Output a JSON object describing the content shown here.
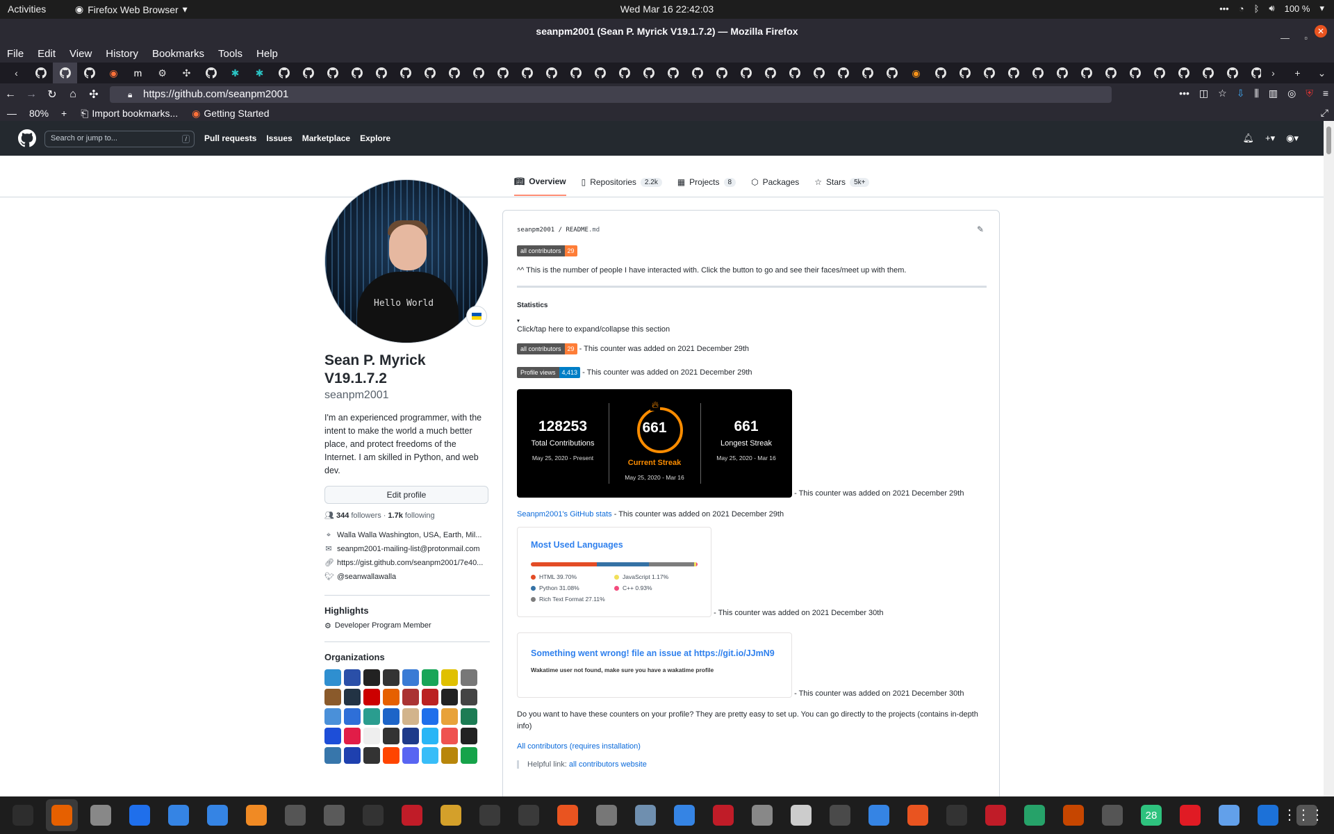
{
  "gnome": {
    "activities": "Activities",
    "app_menu": "Firefox Web Browser",
    "clock": "Wed Mar 16  22:42:03",
    "battery": "100 %"
  },
  "window": {
    "title": "seanpm2001 (Sean P. Myrick V19.1.7.2) — Mozilla Firefox"
  },
  "menubar": [
    "File",
    "Edit",
    "View",
    "History",
    "Bookmarks",
    "Tools",
    "Help"
  ],
  "browser": {
    "url": "https://github.com/seanpm2001",
    "zoom_level": "80%",
    "bookmarks": [
      "Import bookmarks...",
      "Getting Started"
    ]
  },
  "github": {
    "search_placeholder": "Search or jump to...",
    "search_key": "/",
    "nav": [
      "Pull requests",
      "Issues",
      "Marketplace",
      "Explore"
    ],
    "tabs": [
      {
        "label": "Overview",
        "count": ""
      },
      {
        "label": "Repositories",
        "count": "2.2k"
      },
      {
        "label": "Projects",
        "count": "8"
      },
      {
        "label": "Packages",
        "count": ""
      },
      {
        "label": "Stars",
        "count": "5k+"
      }
    ]
  },
  "profile": {
    "avatar_shirt_text": "Hello World",
    "name_line1": "Sean P. Myrick",
    "name_line2": "V19.1.7.2",
    "login": "seanpm2001",
    "bio": "I'm an experienced programmer, with the intent to make the world a much better place, and protect freedoms of the Internet. I am skilled in Python, and web dev.",
    "edit_button": "Edit profile",
    "followers_count": "344",
    "followers_label": "followers",
    "following_count": "1.7k",
    "following_label": "following",
    "location": "Walla Walla Washington, USA, Earth, Mil...",
    "email": "seanpm2001-mailing-list@protonmail.com",
    "website": "https://gist.github.com/seanpm2001/7e40...",
    "twitter": "@seanwallawalla",
    "highlights_title": "Highlights",
    "highlight_item": "Developer Program Member",
    "organizations_title": "Organizations",
    "org_colors": [
      "#2f8fd0",
      "#2a4fa8",
      "#222",
      "#333",
      "#3a7bd5",
      "#18a558",
      "#e0c000",
      "#777",
      "#8a5a2b",
      "#234",
      "#c00",
      "#e66000",
      "#a33",
      "#b22",
      "#222",
      "#444",
      "#4a90d9",
      "#2e6fd8",
      "#2a9d8f",
      "#1c64c8",
      "#d2b48c",
      "#1f6feb",
      "#e8a23a",
      "#1c7c54",
      "#1d4ed8",
      "#e11d48",
      "#eee",
      "#333",
      "#1e3a8a",
      "#29b6f6",
      "#ef5350",
      "#222",
      "#3776ab",
      "#1e40af",
      "#333",
      "#ff4500",
      "#5865f2",
      "#38bdf8",
      "#b8860b",
      "#16a34a"
    ]
  },
  "readme": {
    "path_user": "seanpm2001",
    "path_sep": " / ",
    "path_file": "README",
    "path_ext": ".md",
    "badge_contrib_label": "all contributors",
    "badge_contrib_value": "29",
    "intro": "^^ This is the number of people I have interacted with. Click the button to go and see their faces/meet up with them.",
    "statistics": "Statistics",
    "triangle": "▾",
    "expand_hint": "Click/tap here to expand/collapse this section",
    "added_dec29": "- This counter was added on 2021 December 29th",
    "added_dec30": "- This counter was added on 2021 December 30th",
    "badge_views_label": "Profile views",
    "badge_views_value": "4,413",
    "streak": {
      "total": "128253",
      "total_label": "Total Contributions",
      "total_range": "May 25, 2020 - Present",
      "current": "661",
      "current_label": "Current Streak",
      "current_range": "May 25, 2020 - Mar 16",
      "longest": "661",
      "longest_label": "Longest Streak",
      "longest_range": "May 25, 2020 - Mar 16"
    },
    "stats_link": "Seanpm2001's GitHub stats",
    "languages": {
      "title": "Most Used Languages",
      "items": [
        {
          "name": "HTML",
          "pct": 39.7,
          "label": "HTML 39.70%",
          "color": "#e34c26"
        },
        {
          "name": "Python",
          "pct": 31.08,
          "label": "Python 31.08%",
          "color": "#3572a5"
        },
        {
          "name": "Rich Text Format",
          "pct": 27.11,
          "label": "Rich Text Format 27.11%",
          "color": "#7d7d7d"
        },
        {
          "name": "JavaScript",
          "pct": 1.17,
          "label": "JavaScript 1.17%",
          "color": "#f1e05a"
        },
        {
          "name": "C++",
          "pct": 0.93,
          "label": "C++ 0.93%",
          "color": "#f34b7d"
        }
      ]
    },
    "waka_title": "Something went wrong! file an issue at https://git.io/JJmN9",
    "waka_msg": "Wakatime user not found, make sure you have a wakatime profile",
    "setup_text": "Do you want to have these counters on your profile? They are pretty easy to set up. You can go directly to the projects (contains in-depth info)",
    "all_contrib_link": "All contributors (requires installation)",
    "helpful_label": "Helpful link:",
    "helpful_link": "all contributors website"
  },
  "dock": {
    "calendar_day": "28",
    "app_colors": [
      "#2d2d2d",
      "#e66000",
      "#888",
      "#1f6feb",
      "#3584e4",
      "#3584e4",
      "#f08a24",
      "#555",
      "#5a5a5a",
      "#333",
      "#c01c28",
      "#d4a02a",
      "#3a3a3a",
      "#3a3a3a",
      "#e95420",
      "#777",
      "#6f8faf",
      "#3584e4",
      "#c01c28",
      "#888",
      "#ccc",
      "#4a4a4a",
      "#3584e4",
      "#e95420",
      "#333",
      "#c01c28",
      "#26a269",
      "#c64600",
      "#555",
      "#2ec27e",
      "#e01b24",
      "#62a0ea",
      "#1c71d8",
      "#555"
    ]
  }
}
